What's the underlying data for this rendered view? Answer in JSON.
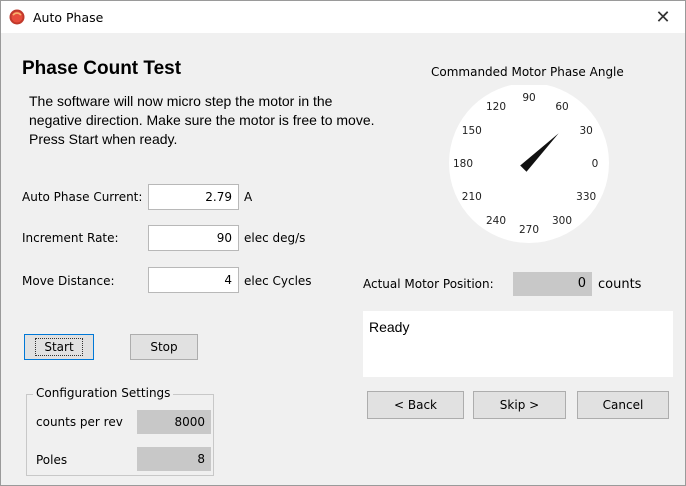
{
  "window": {
    "title": "Auto Phase",
    "close_glyph": "✕"
  },
  "heading": "Phase Count Test",
  "description": "The software will now micro step the motor in the negative direction.  Make sure the motor is free to move. Press Start when ready.",
  "fields": {
    "current": {
      "label": "Auto Phase Current:",
      "value": "2.79",
      "unit": "A"
    },
    "rate": {
      "label": "Increment Rate:",
      "value": "90",
      "unit": "elec deg/s"
    },
    "distance": {
      "label": "Move Distance:",
      "value": "4",
      "unit": "elec Cycles"
    }
  },
  "buttons": {
    "start": "Start",
    "stop": "Stop",
    "back": "< Back",
    "skip": "Skip >",
    "cancel": "Cancel"
  },
  "config": {
    "legend": "Configuration Settings",
    "counts_label": "counts per rev",
    "counts_value": "8000",
    "poles_label": "Poles",
    "poles_value": "8"
  },
  "gauge": {
    "title": "Commanded Motor Phase Angle",
    "labels": [
      "0",
      "30",
      "60",
      "90",
      "120",
      "150",
      "180",
      "210",
      "240",
      "270",
      "300",
      "330"
    ],
    "needle_angle_deg": 45
  },
  "position": {
    "label": "Actual Motor Position:",
    "value": "0",
    "unit": "counts"
  },
  "status": "Ready",
  "colors": {
    "window_bg": "#f0f0f0",
    "readonly_bg": "#c8c8c8",
    "focus_blue": "#0078d7"
  }
}
